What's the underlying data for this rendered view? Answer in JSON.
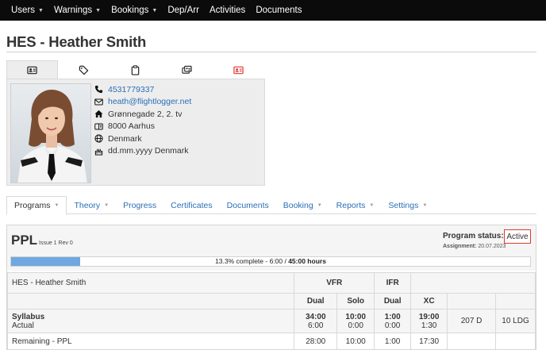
{
  "nav": {
    "items": [
      {
        "label": "Users",
        "caret": "▼"
      },
      {
        "label": "Warnings",
        "caret": "▼"
      },
      {
        "label": "Bookings",
        "caret": "▼"
      },
      {
        "label": "Dep/Arr",
        "caret": ""
      },
      {
        "label": "Activities",
        "caret": ""
      },
      {
        "label": "Documents",
        "caret": ""
      }
    ]
  },
  "page": {
    "title": "HES - Heather Smith"
  },
  "profile_tabs": [
    {
      "icon": "id-card-icon",
      "active": true
    },
    {
      "icon": "tag-icon",
      "active": false
    },
    {
      "icon": "clipboard-icon",
      "active": false
    },
    {
      "icon": "license-icon",
      "active": false
    },
    {
      "icon": "id-card-red-icon",
      "active": false
    }
  ],
  "contact": {
    "phone": "4531779337",
    "email": "heath@flightlogger.net",
    "street": "Grønnegade 2, 2. tv",
    "city": "8000 Aarhus",
    "country": "Denmark",
    "birth": "dd.mm.yyyy Denmark"
  },
  "main_tabs": [
    {
      "label": "Programs",
      "caret": "▼",
      "active": true
    },
    {
      "label": "Theory",
      "caret": "▼",
      "active": false
    },
    {
      "label": "Progress",
      "caret": "",
      "active": false
    },
    {
      "label": "Certificates",
      "caret": "",
      "active": false
    },
    {
      "label": "Documents",
      "caret": "",
      "active": false
    },
    {
      "label": "Booking",
      "caret": "▼",
      "active": false
    },
    {
      "label": "Reports",
      "caret": "▼",
      "active": false
    },
    {
      "label": "Settings",
      "caret": "▼",
      "active": false
    }
  ],
  "program": {
    "name": "PPL",
    "issue": "Issue 1 Rev 0",
    "status_label": "Program status:",
    "status_value": "Active",
    "assignment_label": "Assignment:",
    "assignment_date": "20.07.2023",
    "progress_fraction": 0.133,
    "progress_text": "13.3% complete - 6:00 / ",
    "progress_total": "45:00 hours"
  },
  "table": {
    "student": "HES - Heather Smith",
    "group_vfr": "VFR",
    "group_ifr": "IFR",
    "headers": {
      "dual": "Dual",
      "solo": "Solo",
      "ifr_dual": "Dual",
      "xc": "XC"
    },
    "syllabus_label": "Syllabus",
    "actual_label": "Actual",
    "syllabus": {
      "dual": "34:00",
      "solo": "10:00",
      "ifr": "1:00",
      "xc": "19:00"
    },
    "actual": {
      "dual": "6:00",
      "solo": "0:00",
      "ifr": "0:00",
      "xc": "1:30",
      "days": "207 D",
      "ldg": "10 LDG"
    },
    "remaining_label": "Remaining - PPL",
    "remaining": {
      "dual": "28:00",
      "solo": "10:00",
      "ifr": "1:00",
      "xc": "17:30"
    }
  },
  "colors": {
    "accent_link": "#2a6fb7",
    "nav_bg": "#0b0b0b",
    "progress": "#6fa8e0",
    "status_border": "#e03a2f"
  }
}
